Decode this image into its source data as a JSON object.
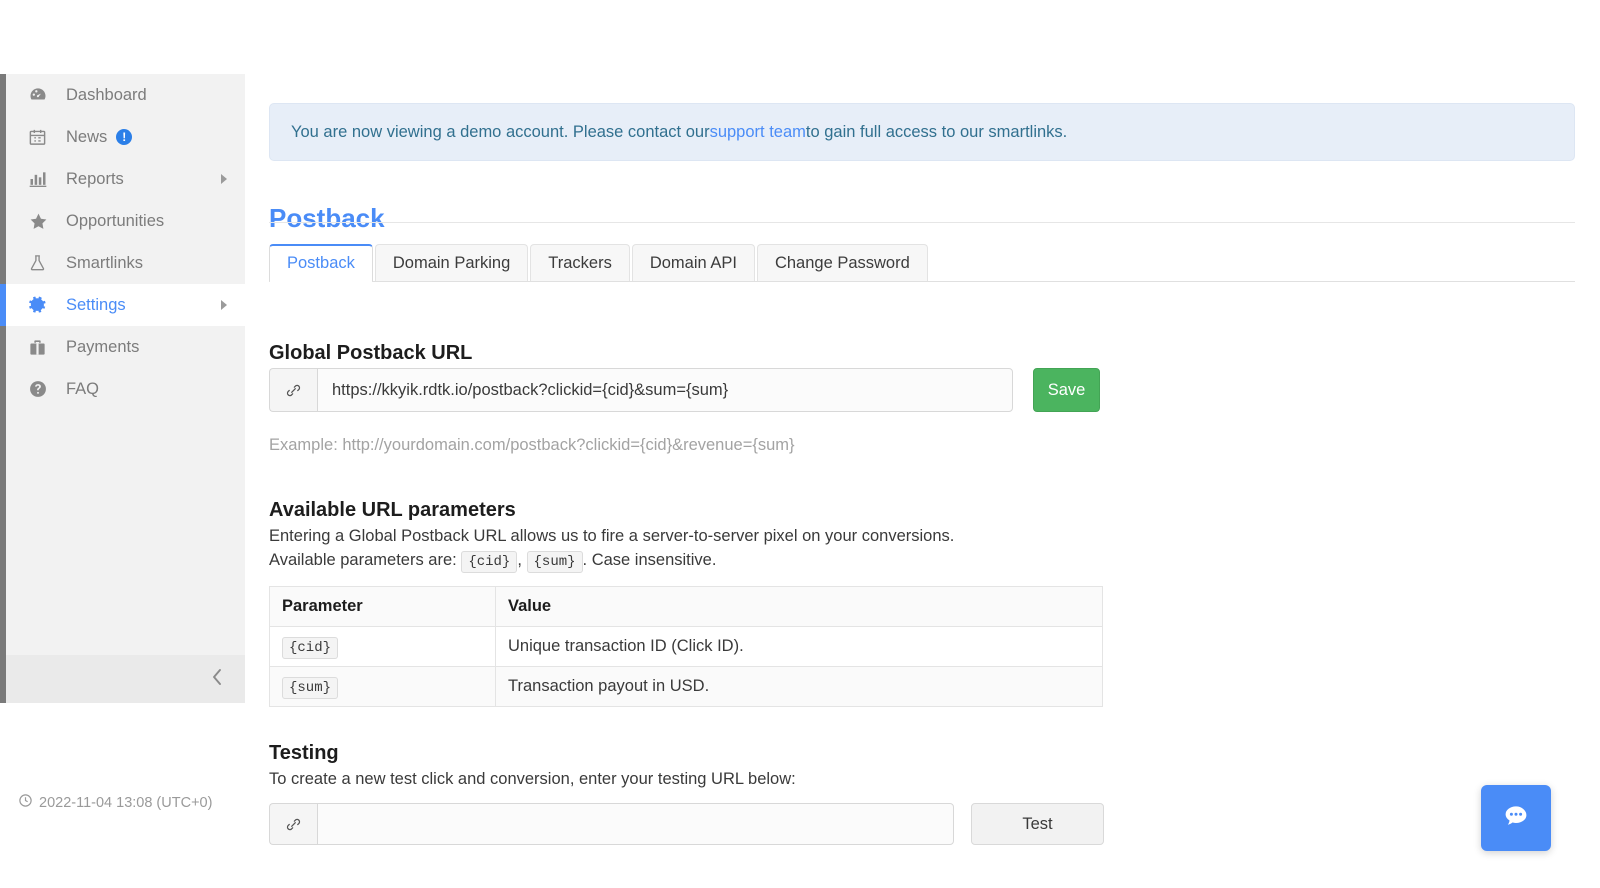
{
  "sidebar": {
    "items": [
      {
        "label": "Dashboard",
        "icon": "dashboard-icon",
        "active": false,
        "caret": false,
        "badge": null
      },
      {
        "label": "News",
        "icon": "calendar-icon",
        "active": false,
        "caret": false,
        "badge": "!"
      },
      {
        "label": "Reports",
        "icon": "bar-chart-icon",
        "active": false,
        "caret": true,
        "badge": null
      },
      {
        "label": "Opportunities",
        "icon": "star-icon",
        "active": false,
        "caret": false,
        "badge": null
      },
      {
        "label": "Smartlinks",
        "icon": "flask-icon",
        "active": false,
        "caret": false,
        "badge": null
      },
      {
        "label": "Settings",
        "icon": "gear-icon",
        "active": true,
        "caret": true,
        "badge": null
      },
      {
        "label": "Payments",
        "icon": "briefcase-icon",
        "active": false,
        "caret": false,
        "badge": null
      },
      {
        "label": "FAQ",
        "icon": "question-circle-icon",
        "active": false,
        "caret": false,
        "badge": null
      }
    ],
    "collapse_icon": "chevron-left-icon",
    "clock_icon": "clock-icon",
    "timestamp": "2022-11-04 13:08 (UTC+0)"
  },
  "banner": {
    "text_before": "You are now viewing a demo account. Please contact our ",
    "link_text": "support team",
    "text_after": " to gain full access to our smartlinks."
  },
  "header": {
    "title": "Postback"
  },
  "tabs": [
    {
      "label": "Postback",
      "active": true
    },
    {
      "label": "Domain Parking",
      "active": false
    },
    {
      "label": "Trackers",
      "active": false
    },
    {
      "label": "Domain API",
      "active": false
    },
    {
      "label": "Change Password",
      "active": false
    }
  ],
  "postback_section": {
    "heading": "Global Postback URL",
    "input_icon": "link-icon",
    "input_value": "https://kkyik.rdtk.io/postback?clickid={cid}&sum={sum}",
    "input_placeholder": "",
    "save_label": "Save",
    "example_text": "Example: http://yourdomain.com/postback?clickid={cid}&revenue={sum}"
  },
  "parameters_section": {
    "heading": "Available URL parameters",
    "line1": "Entering a Global Postback URL allows us to fire a server-to-server pixel on your conversions.",
    "line2_prefix": "Available parameters are:",
    "param_a": "{cid}",
    "separator": ",",
    "param_b": "{sum}",
    "line2_suffix": ". Case insensitive.",
    "table": {
      "columns": [
        "Parameter",
        "Value"
      ],
      "rows": [
        {
          "parameter": "{cid}",
          "value": "Unique transaction ID (Click ID)."
        },
        {
          "parameter": "{sum}",
          "value": "Transaction payout in USD."
        }
      ]
    }
  },
  "testing_section": {
    "heading": "Testing",
    "description": "To create a new test click and conversion, enter your testing URL below:",
    "input_icon": "link-icon",
    "input_value": "",
    "input_placeholder": "",
    "test_label": "Test"
  },
  "chat": {
    "icon": "chat-bubble-icon"
  },
  "colors": {
    "accent": "#4a8cf7",
    "save_green": "#4bb45f",
    "banner_bg": "#e7eef8",
    "banner_text": "#31708f",
    "sidebar_bg": "#f2f2f2",
    "sidebar_rail": "#7a7a7a",
    "muted_text": "#a3a3a3"
  }
}
